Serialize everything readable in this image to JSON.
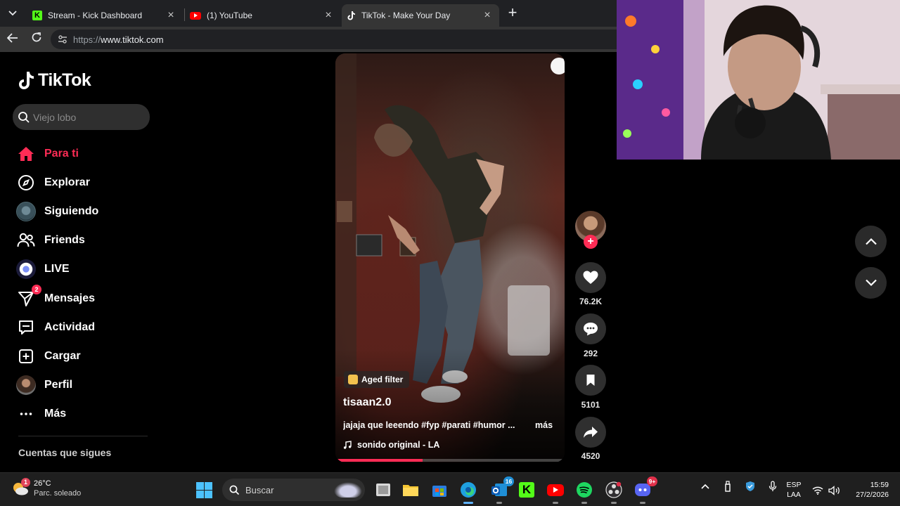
{
  "browser": {
    "tabs": [
      {
        "title": "Stream - Kick Dashboard",
        "favicon": "kick-logo-icon",
        "active": false
      },
      {
        "title": "(1) YouTube",
        "favicon": "youtube-logo-icon",
        "active": false
      },
      {
        "title": "TikTok - Make Your Day",
        "favicon": "tiktok-logo-icon",
        "active": true
      }
    ],
    "url_prefix": "https://",
    "url_host": "www.tiktok.com"
  },
  "tiktok": {
    "logo_text": "TikTok",
    "search_placeholder": "Viejo lobo",
    "accent_color": "#fe2c55",
    "nav": [
      {
        "label": "Para ti",
        "icon": "home-icon",
        "active": true
      },
      {
        "label": "Explorar",
        "icon": "compass-icon"
      },
      {
        "label": "Siguiendo",
        "icon": "following-avatar-icon"
      },
      {
        "label": "Friends",
        "icon": "friends-icon"
      },
      {
        "label": "LIVE",
        "icon": "live-icon"
      },
      {
        "label": "Mensajes",
        "icon": "send-icon",
        "badge": "2"
      },
      {
        "label": "Actividad",
        "icon": "activity-icon"
      },
      {
        "label": "Cargar",
        "icon": "upload-icon"
      },
      {
        "label": "Perfil",
        "icon": "profile-avatar-icon"
      },
      {
        "label": "Más",
        "icon": "more-icon"
      }
    ],
    "following_heading": "Cuentas que sigues",
    "video": {
      "filter_label": "Aged filter",
      "author": "tisaan2.0",
      "caption": "jajaja que leeendo #fyp #parati #humor ...",
      "more_label": "más",
      "music": "sonido original - LA",
      "progress": 0.38
    },
    "actions": {
      "likes": "76.2K",
      "comments": "292",
      "saves": "5101",
      "shares": "4520"
    }
  },
  "taskbar": {
    "weather_temp": "26°C",
    "weather_desc": "Parc. soleado",
    "weather_badge": "1",
    "search_label": "Buscar",
    "outlook_badge": "16",
    "discord_badge": "9+",
    "lang_line1": "ESP",
    "lang_line2": "LAA",
    "time": "15:59",
    "date": "27/2/2026"
  }
}
